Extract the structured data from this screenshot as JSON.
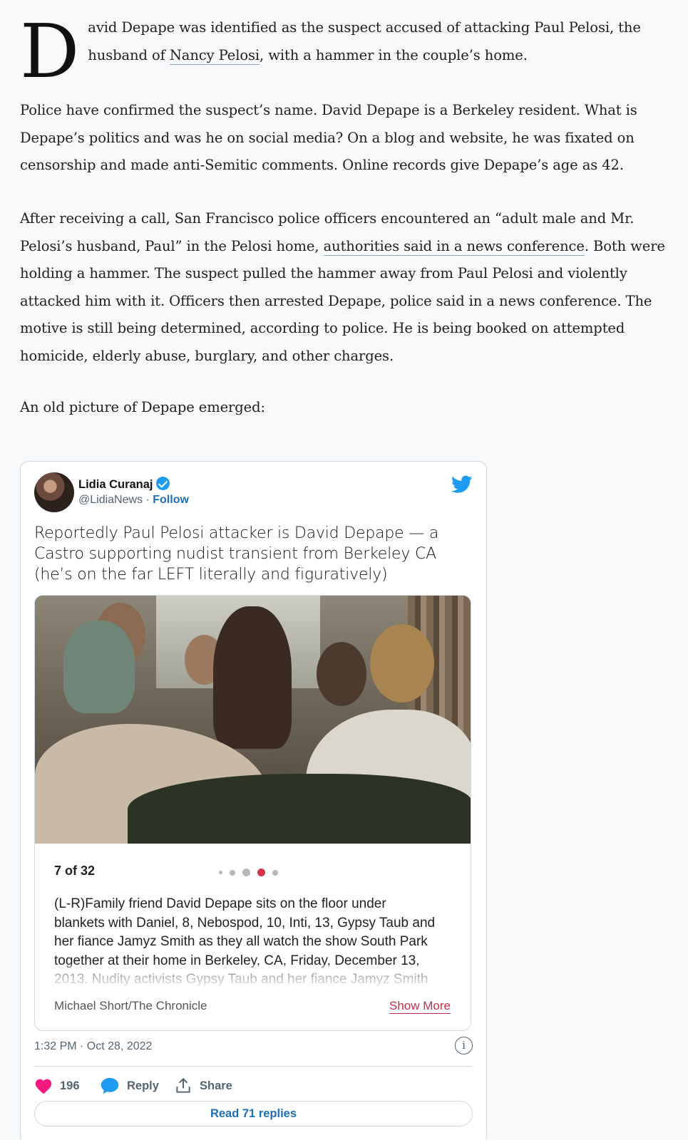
{
  "article": {
    "dropcap": "D",
    "p1_a": "avid Depape was identified as the suspect accused of attacking Paul Pelosi, the husband of ",
    "p1_link": "Nancy Pelosi",
    "p1_b": ", with a hammer in the couple’s home.",
    "p2": "Police have confirmed the suspect’s name. David Depape is a Berkeley resident. What is Depape’s politics and was he on social media? On a blog and website, he was fixated on censorship and made anti-Semitic comments. Online records give Depape’s age as 42.",
    "p3_a": "After receiving a call, San Francisco police officers encountered an “adult male and Mr. Pelosi’s husband, Paul” in the Pelosi home, ",
    "p3_link": "authorities said in a news conference",
    "p3_b": ". Both were holding a hammer. The suspect pulled the hammer away from Paul Pelosi and violently attacked him with it. Officers then arrested Depape, police said in a news conference. The motive is still being de­termined, according to police. He is being booked on attempted homicide, elderly abuse, bur­glary, and other charges.",
    "p4": "An old picture of Depape emerged:"
  },
  "tweet": {
    "author_name": "Lidia Curanaj",
    "handle": "@LidiaNews",
    "separator": " · ",
    "follow_label": "Follow",
    "text": "Reportedly Paul Pelosi attacker is David Depape — a Castro supporting nudist transient from Berkeley CA (he’s on the far LEFT literally and figuratively)",
    "media": {
      "counter": "7 of 32",
      "caption": "(L-R)Family friend David Depape sits on the floor under blankets with Daniel, 8, Nebospod, 10, Inti, 13, Gypsy Taub and her fiance Jamyz Smith as they all watch the show South Park together at their home in Berkeley, CA, Friday, December 13, 2013. Nudity activists Gypsy Taub and her fiance Jamyz Smith are planning a naked wedding on the",
      "credit": "Michael Short/The Chronicle",
      "show_more": "Show More"
    },
    "timestamp": "1:32 PM · Oct 28, 2022",
    "info_glyph": "i",
    "likes": "196",
    "reply_label": "Reply",
    "share_label": "Share",
    "read_replies": "Read 71 replies",
    "colors": {
      "accent": "#1d9bf0",
      "like": "#f91880",
      "link": "#1d6fb8",
      "show_more": "#c32f4a"
    },
    "icons": [
      "twitter-bird-icon",
      "verified-badge-icon",
      "heart-icon",
      "reply-bubble-icon",
      "share-icon",
      "info-icon"
    ]
  }
}
